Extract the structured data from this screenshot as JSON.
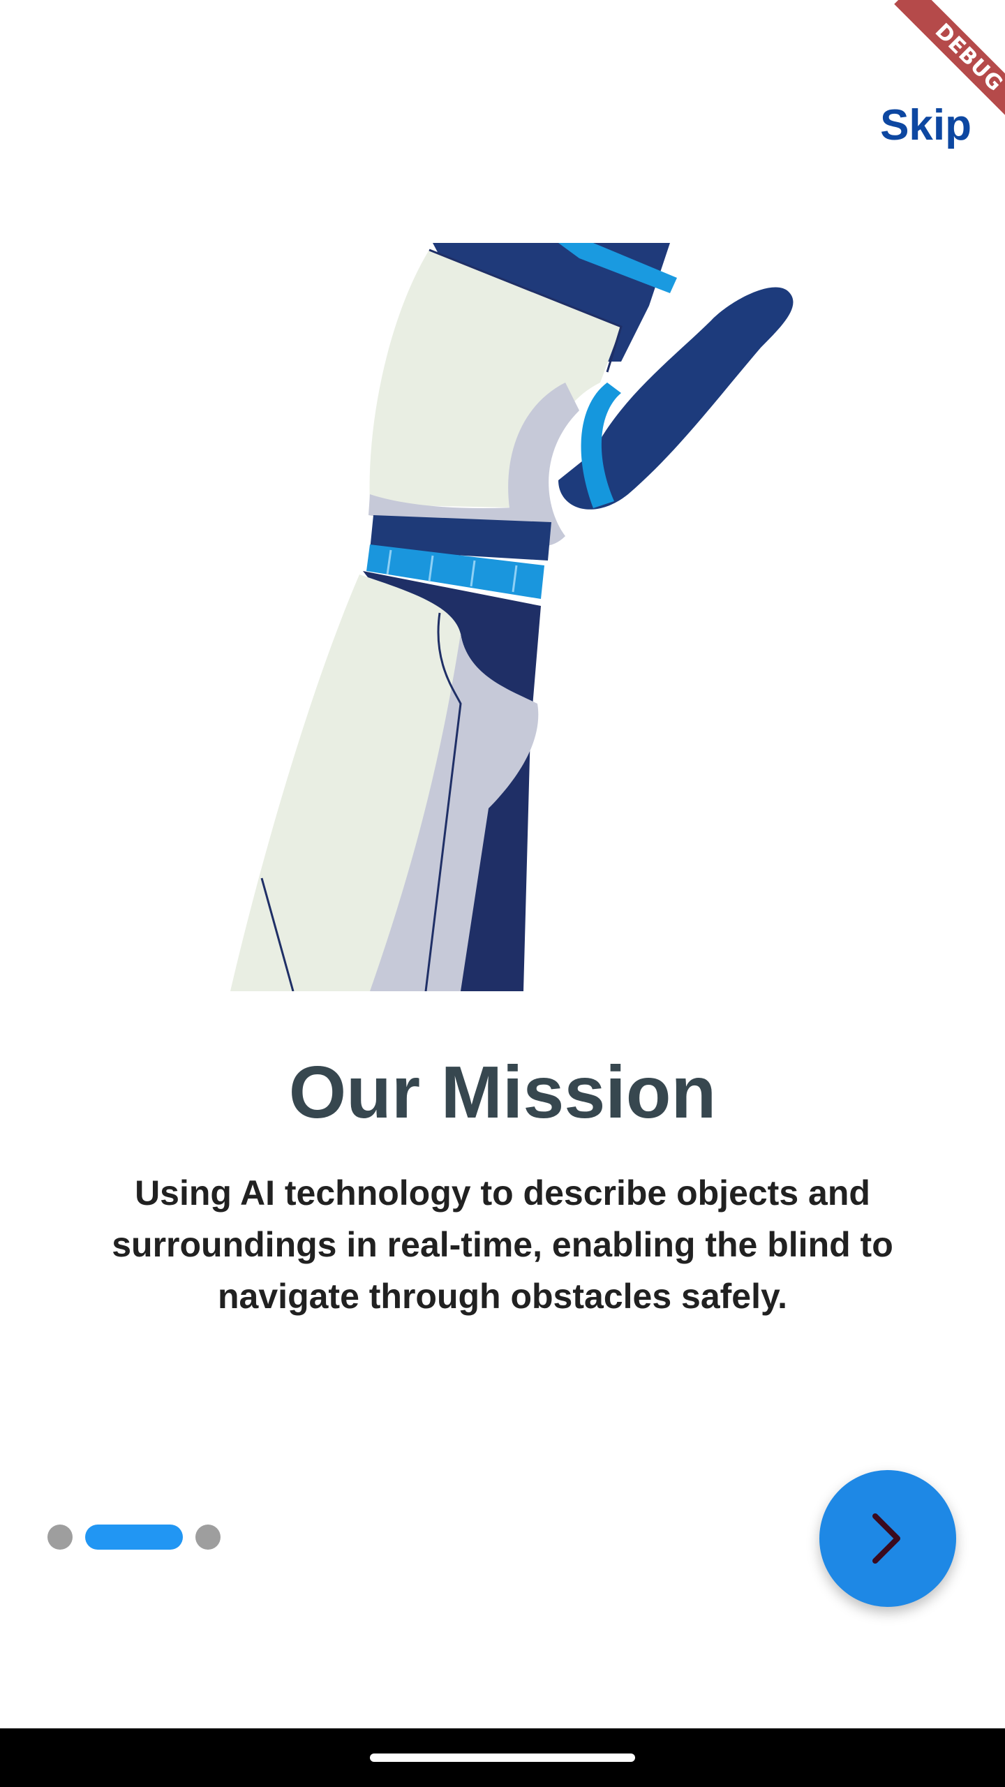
{
  "app": {
    "debug_banner_label": "DEBUG"
  },
  "header": {
    "skip_label": "Skip"
  },
  "onboarding": {
    "title": "Our Mission",
    "description": "Using AI technology to describe objects and surroundings in real-time, enabling the blind to navigate through obstacles safely.",
    "page_count": 3,
    "active_page_index": 1
  },
  "next_button": {
    "icon": "chevron-right-icon"
  },
  "colors": {
    "title": "#37474f",
    "skip": "#0d47a1",
    "active_indicator": "#2196f3",
    "inactive_indicator": "#9e9e9e",
    "fab": "#1e88e5",
    "chevron": "#3b0a1e"
  }
}
